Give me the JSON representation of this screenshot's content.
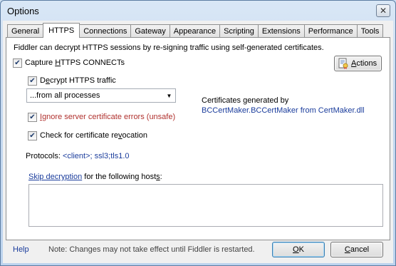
{
  "window": {
    "title": "Options",
    "close_glyph": "✕"
  },
  "tabs": [
    {
      "label": "General"
    },
    {
      "label": "HTTPS",
      "active": true
    },
    {
      "label": "Connections"
    },
    {
      "label": "Gateway"
    },
    {
      "label": "Appearance"
    },
    {
      "label": "Scripting"
    },
    {
      "label": "Extensions"
    },
    {
      "label": "Performance"
    },
    {
      "label": "Tools"
    }
  ],
  "https": {
    "intro": "Fiddler can decrypt HTTPS sessions by re-signing traffic using self-generated certificates.",
    "capture": {
      "label_pre": "Capture ",
      "label_key": "H",
      "label_post": "TTPS CONNECTs",
      "checked": true
    },
    "actions_button": {
      "label_key": "A",
      "label_rest": "ctions",
      "icon": "certificate-icon"
    },
    "decrypt": {
      "label_pre": "D",
      "label_key": "e",
      "label_post": "crypt HTTPS traffic",
      "checked": true
    },
    "process_filter": {
      "value": "...from all processes"
    },
    "ignore_errors": {
      "label_key": "I",
      "label_post": "gnore server certificate errors (unsafe)",
      "checked": true
    },
    "revocation": {
      "label_pre": "Check for certificate re",
      "label_key": "v",
      "label_post": "ocation",
      "checked": true
    },
    "cert_info": {
      "line1": "Certificates generated by",
      "line2": "BCCertMaker.BCCertMaker from CertMaker.dll"
    },
    "protocols": {
      "label": "Protocols: ",
      "value": "<client>; ssl3;tls1.0"
    },
    "skip": {
      "link": "Skip decryption",
      "rest_pre": " for the following host",
      "rest_key": "s",
      "rest_post": ":"
    }
  },
  "footer": {
    "help": "Help",
    "note": "Note: Changes may not take effect until Fiddler is restarted.",
    "ok_key": "O",
    "ok_rest": "K",
    "cancel_pre": "",
    "cancel_key": "C",
    "cancel_rest": "ancel"
  },
  "colors": {
    "link": "#1a3c9c",
    "warning": "#b0312e"
  }
}
